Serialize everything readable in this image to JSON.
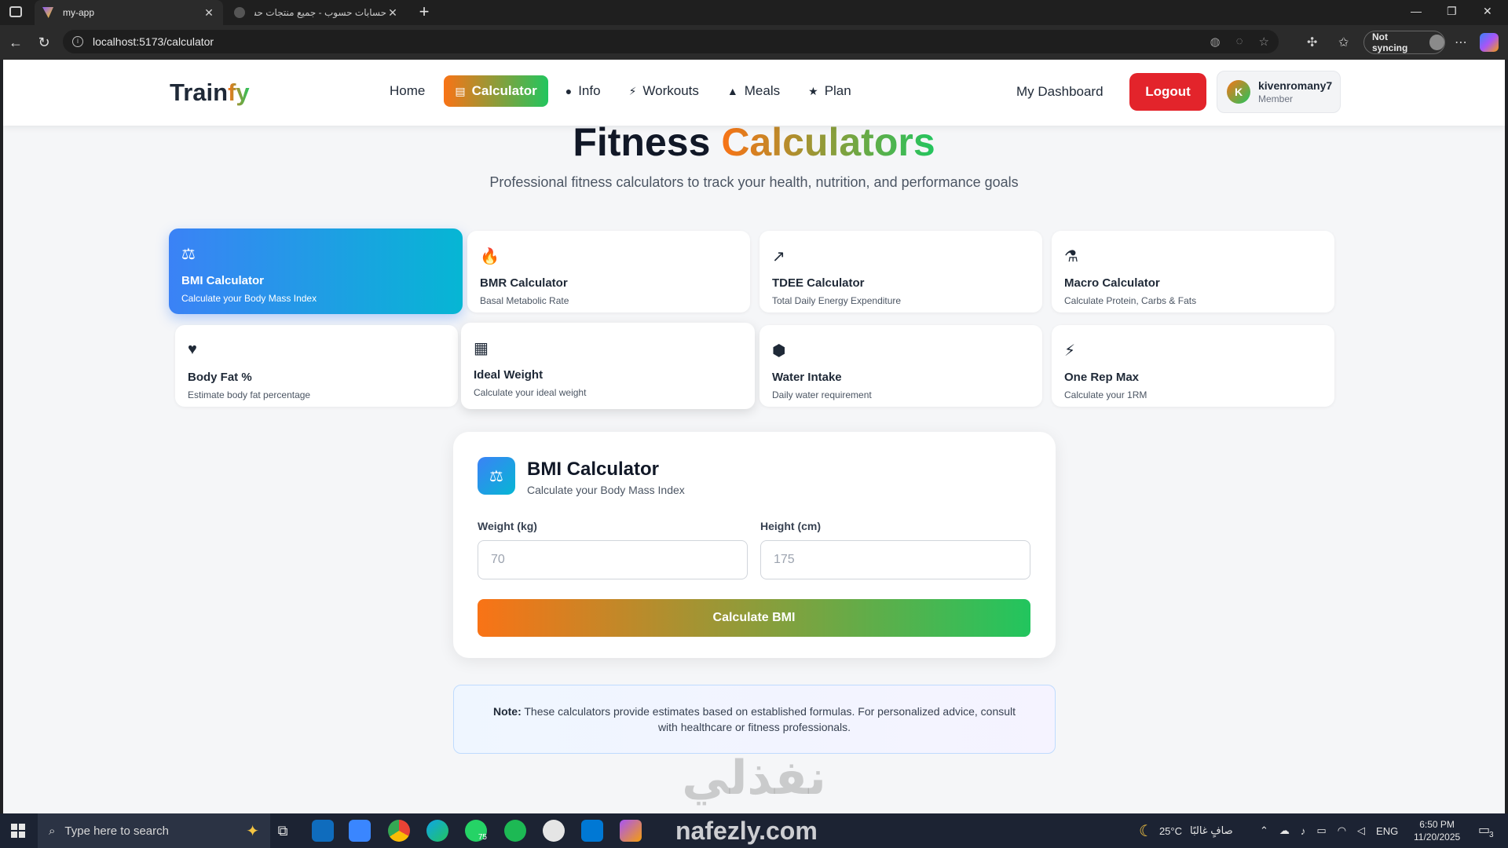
{
  "browser": {
    "tabs": [
      {
        "title": "my-app",
        "active": true
      },
      {
        "title": "حسابات حسوب - جميع منتجات حسوب",
        "active": false
      }
    ],
    "url": "localhost:5173/calculator",
    "sync_label": "Not syncing"
  },
  "header": {
    "logo_main": "Train",
    "logo_accent": "fy",
    "nav": [
      {
        "label": "Home",
        "icon": ""
      },
      {
        "label": "Calculator",
        "icon": "calculator-icon",
        "active": true
      },
      {
        "label": "Info",
        "icon": "user-icon"
      },
      {
        "label": "Workouts",
        "icon": "bolt-icon"
      },
      {
        "label": "Meals",
        "icon": "meal-icon"
      },
      {
        "label": "Plan",
        "icon": "star-icon"
      }
    ],
    "dashboard_label": "My Dashboard",
    "logout_label": "Logout",
    "user": {
      "initial": "K",
      "name": "kivenromany7",
      "role": "Member"
    }
  },
  "hero": {
    "title_main": "Fitness",
    "title_accent": "Calculators",
    "subtitle": "Professional fitness calculators to track your health, nutrition, and performance goals"
  },
  "calculators": [
    {
      "title": "BMI Calculator",
      "desc": "Calculate your Body Mass Index",
      "icon": "scale-icon",
      "glyph": "⚖",
      "selected": true
    },
    {
      "title": "BMR Calculator",
      "desc": "Basal Metabolic Rate",
      "icon": "fire-icon",
      "glyph": "🔥"
    },
    {
      "title": "TDEE Calculator",
      "desc": "Total Daily Energy Expenditure",
      "icon": "trend-up-icon",
      "glyph": "↗"
    },
    {
      "title": "Macro Calculator",
      "desc": "Calculate Protein, Carbs & Fats",
      "icon": "flask-icon",
      "glyph": "⚗"
    },
    {
      "title": "Body Fat %",
      "desc": "Estimate body fat percentage",
      "icon": "heart-icon",
      "glyph": "♥"
    },
    {
      "title": "Ideal Weight",
      "desc": "Calculate your ideal weight",
      "icon": "calculator-icon",
      "glyph": "▦"
    },
    {
      "title": "Water Intake",
      "desc": "Daily water requirement",
      "icon": "cube-icon",
      "glyph": "⬢"
    },
    {
      "title": "One Rep Max",
      "desc": "Calculate your 1RM",
      "icon": "bolt-icon",
      "glyph": "⚡"
    }
  ],
  "bmi_panel": {
    "title": "BMI Calculator",
    "subtitle": "Calculate your Body Mass Index",
    "weight_label": "Weight (kg)",
    "weight_placeholder": "70",
    "weight_value": "",
    "height_label": "Height (cm)",
    "height_placeholder": "175",
    "height_value": "",
    "button_label": "Calculate BMI"
  },
  "note": {
    "label": "Note:",
    "text": "These calculators provide estimates based on established formulas. For personalized advice, consult with healthcare or fitness professionals."
  },
  "watermark": {
    "arabic": "نفذلي",
    "latin": "nafezly.com"
  },
  "taskbar": {
    "search_placeholder": "Type here to search",
    "weather": "25°C",
    "weather_text": "صافٍ غالبًا",
    "language": "ENG",
    "time": "6:50 PM",
    "date": "11/20/2025",
    "whatsapp_badge": "75",
    "notification_count": "3"
  },
  "colors": {
    "brand_orange": "#f97316",
    "brand_green": "#22c55e",
    "selected_blue": "#3b82f6",
    "logout_red": "#e3242b"
  }
}
